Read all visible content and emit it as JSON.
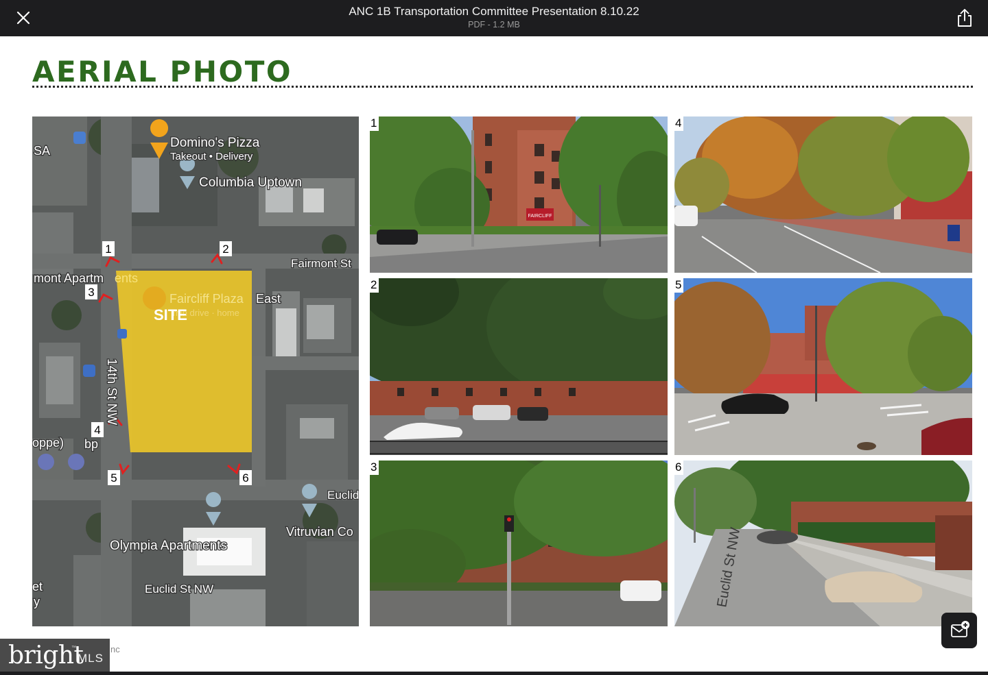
{
  "viewer": {
    "title": "ANC 1B Transportation Committee Presentation 8.10.22",
    "meta": "PDF - 1.2 MB",
    "close_icon": "close-icon",
    "share_icon": "share-icon"
  },
  "slide": {
    "heading": "AERIAL PHOTO",
    "map": {
      "labels": {
        "dominos": "Domino's Pizza",
        "dominos_sub": "Takeout • Delivery",
        "columbia": "Columbia Uptown",
        "fairmont": "Fairmont St",
        "mont_apartments": "mont Apartm",
        "mont_apartments_faded": "ents",
        "faircliff": "Faircliff Plaza",
        "faircliff_east": "East",
        "faircliff_sub": "min drive · home",
        "site": "SITE",
        "street_14th": "14th St NW",
        "oppe": "oppe)",
        "bp": "bp",
        "euclid": "Euclid St NW",
        "euclid2": "Euclid",
        "vitruvian": "Vitruvian Co",
        "olympia": "Olympia Apartments",
        "sa": "SA",
        "et": "et",
        "y": "y"
      },
      "markers": [
        "1",
        "2",
        "3",
        "4",
        "5",
        "6"
      ]
    },
    "photos": [
      {
        "number": "1"
      },
      {
        "number": "2"
      },
      {
        "number": "3"
      },
      {
        "number": "4"
      },
      {
        "number": "5"
      },
      {
        "number": "6"
      }
    ],
    "photo_text": {
      "sign_1": "FAIRCLIFF",
      "street_sign_6": "Euclid St NW"
    }
  },
  "footer": {
    "brand_word": "bright",
    "brand_mls": "MLS",
    "brand_tm": "™",
    "fragment": "nc",
    "floating_icon": "add-to-inbox-icon"
  },
  "colors": {
    "heading_green": "#2d6a1f",
    "site_yellow": "#e8c42c",
    "topbar": "#1d1d1f",
    "marker_red": "#e02020"
  }
}
